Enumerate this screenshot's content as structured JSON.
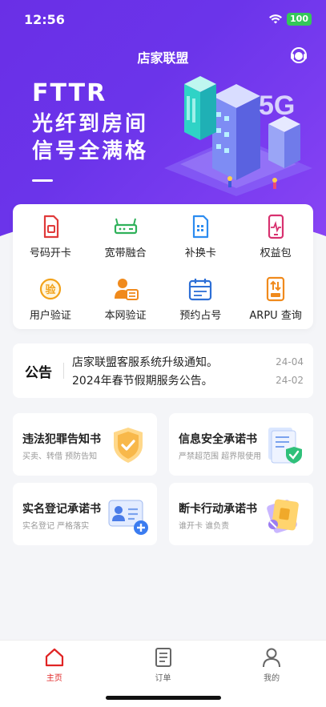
{
  "status": {
    "time": "12:56",
    "battery": "100"
  },
  "header": {
    "title": "店家联盟"
  },
  "banner": {
    "line1": "FTTR",
    "line2": "光纤到房间",
    "line3": "信号全满格"
  },
  "menu": [
    {
      "label": "号码开卡",
      "icon": "sim-card-icon",
      "color": "#e03a3a"
    },
    {
      "label": "宽带融合",
      "icon": "router-icon",
      "color": "#2fb15a"
    },
    {
      "label": "补换卡",
      "icon": "sim-card-blue-icon",
      "color": "#2d8cf0"
    },
    {
      "label": "权益包",
      "icon": "phone-heartbeat-icon",
      "color": "#d8316f"
    },
    {
      "label": "用户验证",
      "icon": "verify-badge-icon",
      "color": "#f2a21a"
    },
    {
      "label": "本网验证",
      "icon": "user-card-icon",
      "color": "#f08a1c"
    },
    {
      "label": "预约占号",
      "icon": "calendar-icon",
      "color": "#2d6fd6"
    },
    {
      "label": "ARPU 查询",
      "icon": "arpu-query-icon",
      "color": "#f08a1c"
    }
  ],
  "notice": {
    "logo": "公告",
    "items": [
      {
        "title": "店家联盟客服系统升级通知。",
        "date": "24-04"
      },
      {
        "title": "2024年春节假期服务公告。",
        "date": "24-02"
      }
    ]
  },
  "promises": [
    {
      "title": "违法犯罪告知书",
      "sub": "买卖、转借 预防告知"
    },
    {
      "title": "信息安全承诺书",
      "sub": "严禁超范围 超界限使用"
    },
    {
      "title": "实名登记承诺书",
      "sub": "实名登记 严格落实"
    },
    {
      "title": "断卡行动承诺书",
      "sub": "谁开卡 谁负责"
    }
  ],
  "tabs": [
    {
      "label": "主页",
      "active": true
    },
    {
      "label": "订单",
      "active": false
    },
    {
      "label": "我的",
      "active": false
    }
  ],
  "colors": {
    "hero": "#6b34ea",
    "accent": "#e02424"
  }
}
